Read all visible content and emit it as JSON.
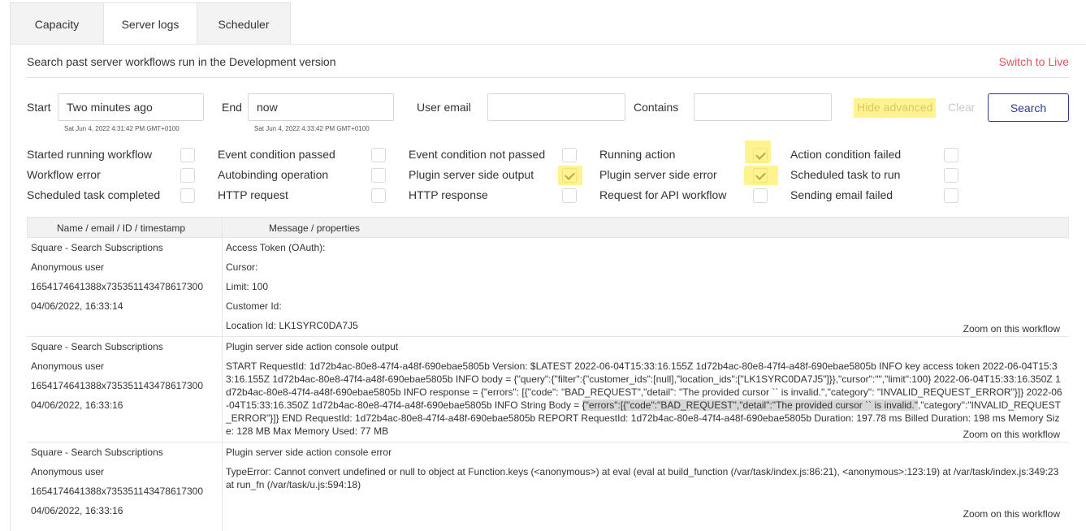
{
  "tabs": [
    {
      "label": "Capacity"
    },
    {
      "label": "Server logs"
    },
    {
      "label": "Scheduler"
    }
  ],
  "description": "Search past server workflows run in the Development version",
  "switch_live": "Switch to Live",
  "filters": {
    "start_label": "Start",
    "start_value": "Two minutes ago",
    "start_sub": "Sat Jun 4, 2022 4:31:42 PM GMT+0100",
    "end_label": "End",
    "end_value": "now",
    "end_sub": "Sat Jun 4, 2022 4:33:42 PM GMT+0100",
    "user_email_label": "User email",
    "user_email_value": "",
    "contains_label": "Contains",
    "contains_value": "",
    "hide_advanced": "Hide advanced",
    "clear": "Clear",
    "search": "Search"
  },
  "checkboxes": [
    {
      "label": "Started running workflow",
      "checked": false
    },
    {
      "label": "Event condition passed",
      "checked": false
    },
    {
      "label": "Event condition not passed",
      "checked": false
    },
    {
      "label": "Running action",
      "checked": true
    },
    {
      "label": "Action condition failed",
      "checked": false
    },
    {
      "label": "Workflow error",
      "checked": false
    },
    {
      "label": "Autobinding operation",
      "checked": false
    },
    {
      "label": "Plugin server side output",
      "checked": true
    },
    {
      "label": "Plugin server side error",
      "checked": true
    },
    {
      "label": "Scheduled task to run",
      "checked": false
    },
    {
      "label": "Scheduled task completed",
      "checked": false
    },
    {
      "label": "HTTP request",
      "checked": false
    },
    {
      "label": "HTTP response",
      "checked": false
    },
    {
      "label": "Request for API workflow",
      "checked": false
    },
    {
      "label": "Sending email failed",
      "checked": false
    }
  ],
  "table": {
    "col1_header": "Name / email / ID / timestamp",
    "col2_header": "Message / properties",
    "zoom_label": "Zoom on this workflow",
    "rows": [
      {
        "name": "Square - Search Subscriptions",
        "user": "Anonymous user",
        "id": "1654174641388x735351143478617300",
        "timestamp": "04/06/2022, 16:33:14",
        "lines": [
          "Access Token (OAuth):",
          "Cursor:",
          "Limit: 100",
          "Customer Id:",
          "Location Id: LK1SYRC0DA7J5"
        ]
      },
      {
        "name": "Square - Search Subscriptions",
        "user": "Anonymous user",
        "id": "1654174641388x735351143478617300",
        "timestamp": "04/06/2022, 16:33:16",
        "title": "Plugin server side action console output",
        "body_part1": "START RequestId: 1d72b4ac-80e8-47f4-a48f-690ebae5805b Version: $LATEST 2022-06-04T15:33:16.155Z 1d72b4ac-80e8-47f4-a48f-690ebae5805b INFO key access token 2022-06-04T15:33:16.155Z 1d72b4ac-80e8-47f4-a48f-690ebae5805b INFO body = {\"query\":{\"filter\":{\"customer_ids\":[null],\"location_ids\":[\"LK1SYRC0DA7J5\"]}},\"cursor\":\"\",\"limit\":100} 2022-06-04T15:33:16.350Z 1d72b4ac-80e8-47f4-a48f-690ebae5805b INFO response = {\"errors\": [{\"code\": \"BAD_REQUEST\",\"detail\": \"The provided cursor `` is invalid.\",\"category\": \"INVALID_REQUEST_ERROR\"}]} 2022-06-04T15:33:16.350Z 1d72b4ac-80e8-47f4-a48f-690ebae5805b INFO String Body = ",
        "body_selected": "{\"errors\":[{\"code\":\"BAD_REQUEST\",\"detail\":\"The provided cursor `` is invalid.\"",
        "body_part2": ",\"category\":\"INVALID_REQUEST_ERROR\"}]} END RequestId: 1d72b4ac-80e8-47f4-a48f-690ebae5805b REPORT RequestId: 1d72b4ac-80e8-47f4-a48f-690ebae5805b Duration: 197.78 ms Billed Duration: 198 ms Memory Size: 128 MB Max Memory Used: 77 MB"
      },
      {
        "name": "Square - Search Subscriptions",
        "user": "Anonymous user",
        "id": "1654174641388x735351143478617300",
        "timestamp": "04/06/2022, 16:33:16",
        "title": "Plugin server side action console error",
        "body": "TypeError: Cannot convert undefined or null to object at Function.keys (<anonymous>) at eval (eval at build_function (/var/task/index.js:86:21), <anonymous>:123:19) at /var/task/index.js:349:23 at run_fn (/var/task/u.js:594:18)"
      }
    ]
  },
  "colors": {
    "accent": "#2c3c94",
    "live": "#e8505b",
    "highlight": "#fff38f"
  }
}
